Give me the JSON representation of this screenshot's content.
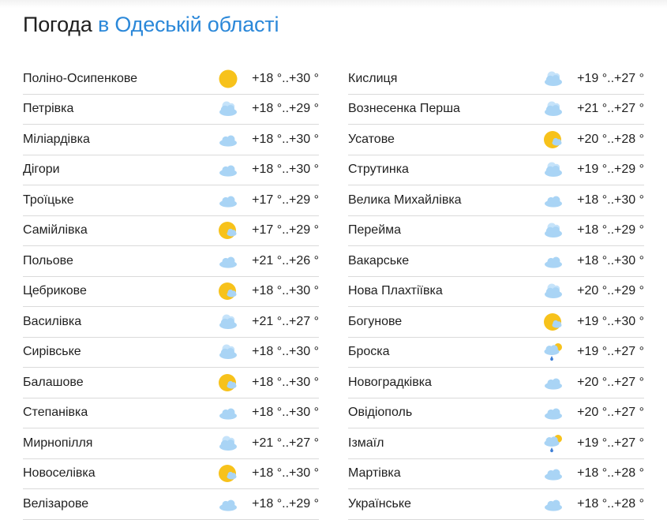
{
  "header": {
    "title_plain": "Погода",
    "title_accent": "в Одеській області"
  },
  "columns": [
    [
      {
        "name": "Поліно-Осипенкове",
        "temp": "+18 °..+30 °",
        "icon": "sun-icon"
      },
      {
        "name": "Петрівка",
        "temp": "+18 °..+29 °",
        "icon": "cloudy-icon"
      },
      {
        "name": "Міліардівка",
        "temp": "+18 °..+30 °",
        "icon": "light-cloud-icon"
      },
      {
        "name": "Дігори",
        "temp": "+18 °..+30 °",
        "icon": "light-cloud-icon"
      },
      {
        "name": "Троїцьке",
        "temp": "+17 °..+29 °",
        "icon": "light-cloud-icon"
      },
      {
        "name": "Самійлівка",
        "temp": "+17 °..+29 °",
        "icon": "sun-cloud-icon"
      },
      {
        "name": "Польове",
        "temp": "+21 °..+26 °",
        "icon": "light-cloud-icon"
      },
      {
        "name": "Цебрикове",
        "temp": "+18 °..+30 °",
        "icon": "sun-cloud-icon"
      },
      {
        "name": "Василівка",
        "temp": "+21 °..+27 °",
        "icon": "cloudy-icon"
      },
      {
        "name": "Сирівське",
        "temp": "+18 °..+30 °",
        "icon": "cloudy-icon"
      },
      {
        "name": "Балашове",
        "temp": "+18 °..+30 °",
        "icon": "sun-cloud-icon"
      },
      {
        "name": "Степанівка",
        "temp": "+18 °..+30 °",
        "icon": "light-cloud-icon"
      },
      {
        "name": "Мирнопілля",
        "temp": "+21 °..+27 °",
        "icon": "cloudy-icon"
      },
      {
        "name": "Новоселівка",
        "temp": "+18 °..+30 °",
        "icon": "sun-cloud-icon"
      },
      {
        "name": "Велізарове",
        "temp": "+18 °..+29 °",
        "icon": "light-cloud-icon"
      }
    ],
    [
      {
        "name": "Кислиця",
        "temp": "+19 °..+27 °",
        "icon": "cloudy-icon"
      },
      {
        "name": "Вознесенка Перша",
        "temp": "+21 °..+27 °",
        "icon": "cloudy-icon"
      },
      {
        "name": "Усатове",
        "temp": "+20 °..+28 °",
        "icon": "sun-cloud-icon"
      },
      {
        "name": "Струтинка",
        "temp": "+19 °..+29 °",
        "icon": "cloudy-icon"
      },
      {
        "name": "Велика Михайлівка",
        "temp": "+18 °..+30 °",
        "icon": "light-cloud-icon"
      },
      {
        "name": "Перейма",
        "temp": "+18 °..+29 °",
        "icon": "cloudy-icon"
      },
      {
        "name": "Вакарське",
        "temp": "+18 °..+30 °",
        "icon": "light-cloud-icon"
      },
      {
        "name": "Нова Плахтіївка",
        "temp": "+20 °..+29 °",
        "icon": "cloudy-icon"
      },
      {
        "name": "Богунове",
        "temp": "+19 °..+30 °",
        "icon": "sun-cloud-icon"
      },
      {
        "name": "Броска",
        "temp": "+19 °..+27 °",
        "icon": "rain-sun-icon"
      },
      {
        "name": "Новоградківка",
        "temp": "+20 °..+27 °",
        "icon": "light-cloud-icon"
      },
      {
        "name": "Овідіополь",
        "temp": "+20 °..+27 °",
        "icon": "light-cloud-icon"
      },
      {
        "name": "Ізмаїл",
        "temp": "+19 °..+27 °",
        "icon": "rain-sun-icon"
      },
      {
        "name": "Мартівка",
        "temp": "+18 °..+28 °",
        "icon": "light-cloud-icon"
      },
      {
        "name": "Українське",
        "temp": "+18 °..+28 °",
        "icon": "light-cloud-icon"
      }
    ]
  ],
  "colors": {
    "accent": "#2b88d9",
    "sun": "#f7c21b",
    "cloud": "#a9d4f5",
    "rain": "#3f7fd6"
  }
}
